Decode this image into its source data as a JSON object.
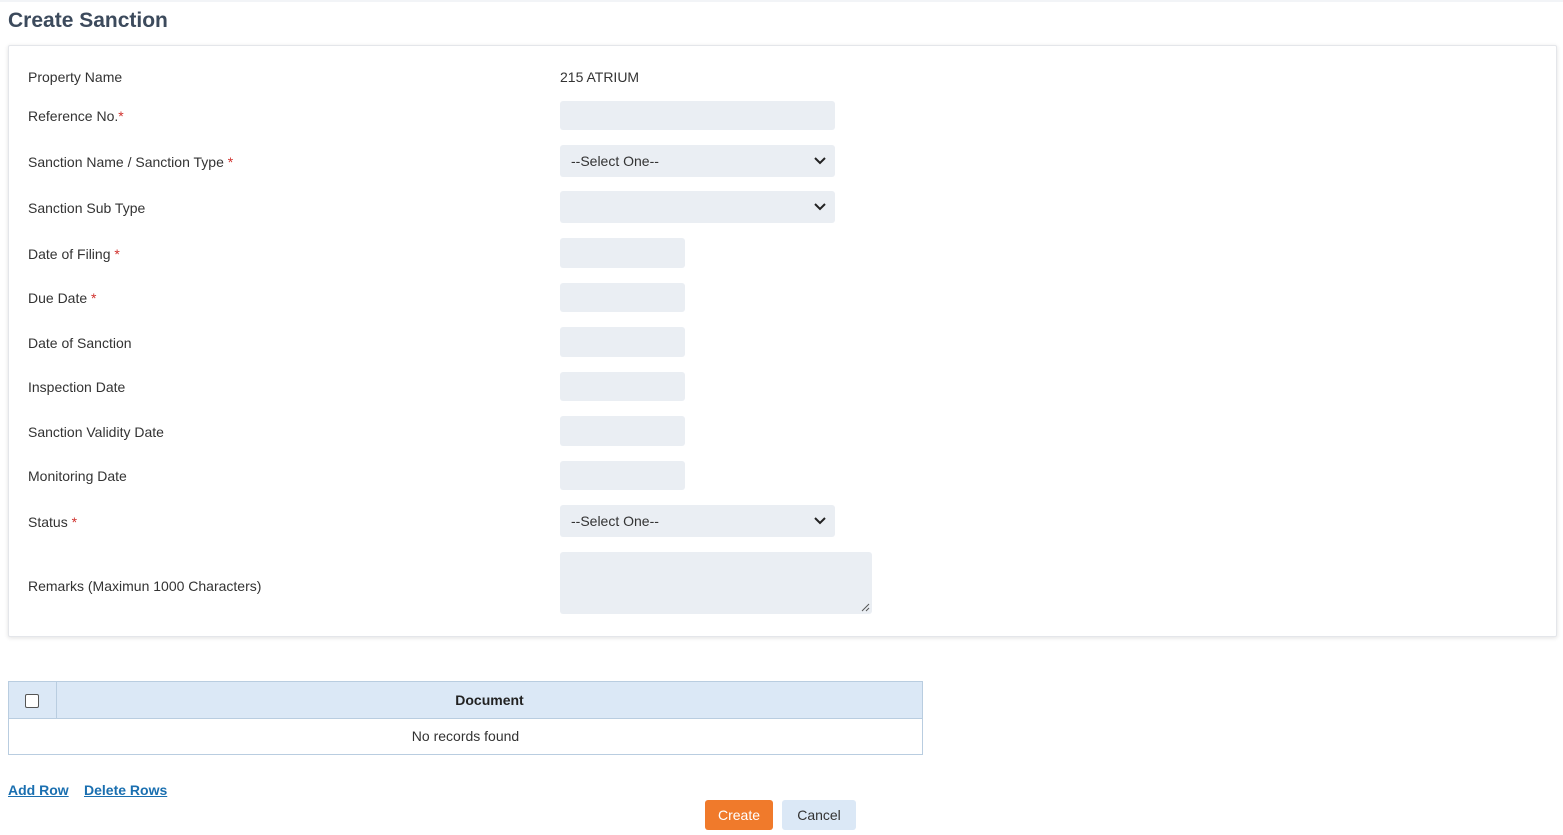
{
  "page": {
    "title": "Create Sanction"
  },
  "form": {
    "property_name": {
      "label": "Property Name",
      "value": "215 ATRIUM"
    },
    "reference_no": {
      "label": "Reference No.",
      "required_mark": "*",
      "value": ""
    },
    "sanction_type": {
      "label": "Sanction Name / Sanction Type",
      "required_mark": "*",
      "selected": "--Select One--"
    },
    "sanction_sub_type": {
      "label": "Sanction Sub Type",
      "selected": ""
    },
    "date_of_filing": {
      "label": "Date of Filing",
      "required_mark": "*",
      "value": ""
    },
    "due_date": {
      "label": "Due Date",
      "required_mark": "*",
      "value": ""
    },
    "date_of_sanction": {
      "label": "Date of Sanction",
      "value": ""
    },
    "inspection_date": {
      "label": "Inspection Date",
      "value": ""
    },
    "sanction_validity_date": {
      "label": "Sanction Validity Date",
      "value": ""
    },
    "monitoring_date": {
      "label": "Monitoring Date",
      "value": ""
    },
    "status": {
      "label": "Status",
      "required_mark": "*",
      "selected": "--Select One--"
    },
    "remarks": {
      "label": "Remarks (Maximun 1000 Characters)",
      "value": ""
    }
  },
  "documents": {
    "column": "Document",
    "empty_message": "No records found"
  },
  "actions": {
    "add_row": "Add Row",
    "delete_rows": "Delete Rows",
    "create": "Create",
    "cancel": "Cancel"
  },
  "colors": {
    "accent": "#f07a2b",
    "link": "#1a6fb0",
    "field_bg": "#eaeef3",
    "table_header_bg": "#dbe8f6",
    "required": "#d0312d"
  }
}
